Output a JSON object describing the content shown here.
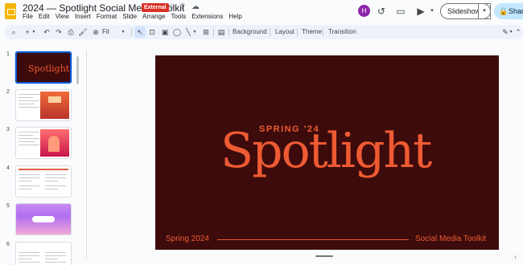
{
  "app": {
    "doc_title": "2024 — Spotlight Social Media Toolkit",
    "badge": "External",
    "menu": [
      "File",
      "Edit",
      "View",
      "Insert",
      "Format",
      "Slide",
      "Arrange",
      "Tools",
      "Extensions",
      "Help"
    ],
    "avatar_initial": "H",
    "slideshow_label": "Slideshow",
    "share_label": "Share"
  },
  "toolbar": {
    "zoom": "Fit",
    "background_label": "Background",
    "layout_label": "Layout",
    "theme_label": "Theme",
    "transition_label": "Transition"
  },
  "filmstrip": {
    "slides": [
      {
        "number": "1",
        "thumb_text": "Spotlight"
      },
      {
        "number": "2"
      },
      {
        "number": "3"
      },
      {
        "number": "4"
      },
      {
        "number": "5"
      },
      {
        "number": "6"
      }
    ]
  },
  "slide": {
    "kicker": "SPRING '24",
    "headline": "Spotlight",
    "footer_left": "Spring 2024",
    "footer_right": "Social Media Toolkit",
    "background_color": "#3d0b0b",
    "accent_color": "#ee5a32"
  },
  "icons": [
    "star-icon",
    "move-to-folder-icon",
    "cloud-status-icon",
    "history-icon",
    "comment-icon",
    "meet-icon",
    "lock-icon"
  ]
}
